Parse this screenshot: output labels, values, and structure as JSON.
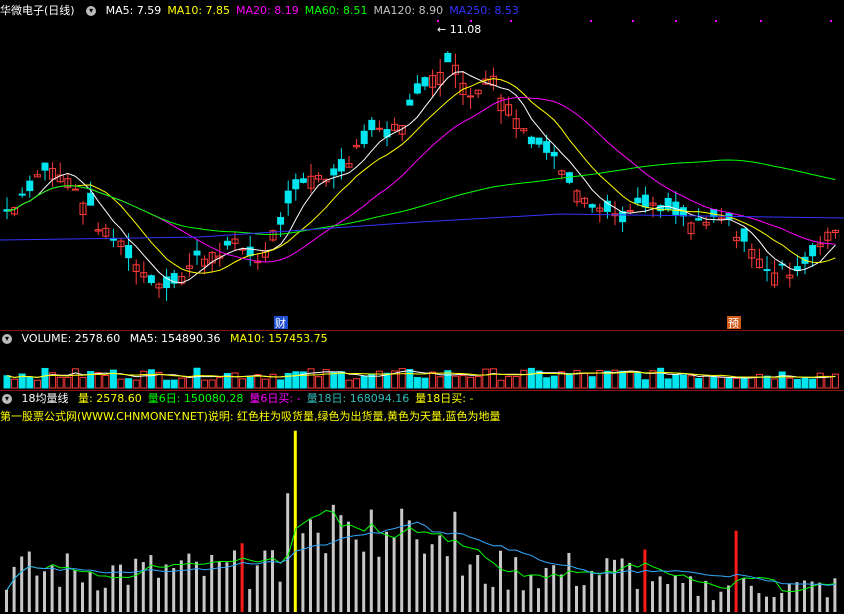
{
  "main": {
    "stock_name": "华微电子",
    "period": "(日线)",
    "ma": [
      {
        "label": "MA5: 7.59",
        "color": "#ffffff"
      },
      {
        "label": "MA10: 7.85",
        "color": "#ffff00"
      },
      {
        "label": "MA20: 8.19",
        "color": "#ff00ff"
      },
      {
        "label": "MA60: 8.51",
        "color": "#00ff00"
      },
      {
        "label": "MA120: 8.90",
        "color": "#c0c0c0"
      },
      {
        "label": "MA250: 8.53",
        "color": "#3333ff"
      }
    ],
    "high_label": "11.08",
    "marker_cai": "财",
    "marker_yu": "预"
  },
  "volume": {
    "title": "VOLUME: 2578.60",
    "ma5": "MA5: 154890.36",
    "ma10": "MA10: 157453.75"
  },
  "indicator": {
    "name": "18均量线",
    "items": [
      {
        "label": "量: 2578.60",
        "color": "#ffff00"
      },
      {
        "label": "量6日: 150080.28",
        "color": "#00ff00"
      },
      {
        "label": "量6日买: -",
        "color": "#ff00ff"
      },
      {
        "label": "量18日: 168094.16",
        "color": "#33bbbb"
      },
      {
        "label": "量18日买: -",
        "color": "#ffff00"
      }
    ],
    "note": "第一股票公式网(WWW.CHNMONEY.NET)说明: 红色柱为吸货量,绿色为出货量,黄色为天量,蓝色为地量"
  },
  "colors": {
    "up": "#ff3b3b",
    "down": "#00e5ee",
    "ma5": "#ffffff",
    "ma10": "#ffff00",
    "ma20": "#ff00ff",
    "ma60": "#00ff00",
    "ma250": "#3333ff",
    "vol_bar": "#c8c8c8",
    "vol_red": "#ff1a1a",
    "vol_yellow": "#ffff00",
    "ma6_line": "#00ff00",
    "ma18_line": "#33aaff"
  },
  "chart_data": {
    "type": "candlestick",
    "price_range": [
      6.3,
      11.3
    ],
    "high": 11.08,
    "close_path": [
      7.9,
      8.3,
      8.7,
      8.5,
      8.1,
      7.5,
      7.3,
      6.8,
      6.6,
      6.7,
      7.1,
      7.2,
      7.3,
      7.0,
      7.6,
      8.2,
      8.6,
      8.5,
      9.0,
      9.4,
      9.3,
      9.8,
      10.4,
      10.6,
      10.0,
      10.4,
      9.8,
      9.3,
      9.0,
      8.6,
      8.2,
      7.9,
      7.8,
      8.0,
      7.9,
      7.8,
      7.6,
      7.8,
      7.5,
      7.0,
      6.8,
      6.9,
      7.2,
      7.59
    ],
    "ma_values": {
      "MA5": 7.59,
      "MA10": 7.85,
      "MA20": 8.19,
      "MA60": 8.51,
      "MA120": 8.9,
      "MA250": 8.53
    },
    "volume": {
      "last": 2578.6,
      "ma5": 154890.36,
      "ma10": 157453.75
    },
    "indicator": {
      "vol": 2578.6,
      "vol_ma6": 150080.28,
      "vol_ma18": 168094.16
    }
  }
}
